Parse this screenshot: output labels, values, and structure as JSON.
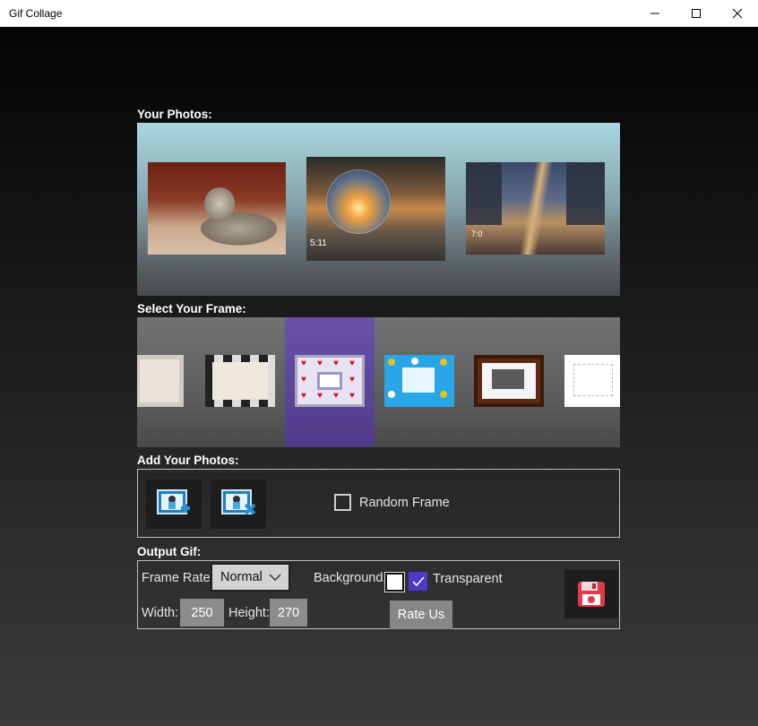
{
  "window": {
    "title": "Gif Collage",
    "controls": [
      "minimize-icon",
      "maximize-icon",
      "close-icon"
    ]
  },
  "sections": {
    "photos_label": "Your Photos:",
    "frame_label": "Select Your Frame:",
    "add_label": "Add Your Photos:",
    "output_label": "Output Gif:"
  },
  "photos": [
    {
      "name": "cat-photo",
      "overlay": ""
    },
    {
      "name": "crystal-ball-photo",
      "overlay": "5:11"
    },
    {
      "name": "city-street-photo",
      "overlay": "7:0"
    }
  ],
  "frames": {
    "selected_index": 2,
    "items": [
      "beige-stone-frame",
      "checker-frame",
      "hearts-frame",
      "blue-flower-frame",
      "wooden-frame",
      "white-puzzle-frame"
    ]
  },
  "add_photos": {
    "buttons": [
      "add-photo-icon",
      "remove-photo-icon"
    ],
    "random_frame_label": "Random Frame",
    "random_frame_checked": false
  },
  "output": {
    "frame_rate_label": "Frame Rate:",
    "frame_rate_value": "Normal",
    "background_label": "Background:",
    "background_color": "#ffffff",
    "transparent_label": "Transparent",
    "transparent_checked": true,
    "width_label": "Width:",
    "width_value": "250",
    "height_label": "Height:",
    "height_value": "270",
    "rate_button": "Rate Us",
    "save_icon": "save-disk-icon"
  },
  "colors": {
    "accent": "#4b3bc8",
    "selected_frame_bg": "#5d4a9a"
  }
}
